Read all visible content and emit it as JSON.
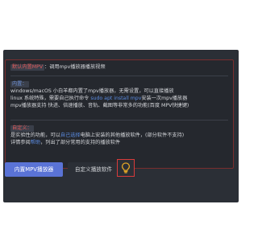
{
  "tooltip": {
    "section1": {
      "tag": "默认内置MPV",
      "text": "：调用mpv播放器播放视频"
    },
    "section2": {
      "tag": "内置：",
      "line1": "windows/macOS 小白羊都内置了mpv播放器，无需设置，可以直接播放",
      "line2_a": "linux 系统特殊，需要自己执行命令 ",
      "line2_cmd": "sudo apt install mpv",
      "line2_b": "安装一次mpv播放器",
      "line3": "mpv播放器支持 快进、倍速播放、音轨、截图等非常多的功能(百度 MPV快捷键)"
    },
    "section3": {
      "tag": "自定义：",
      "line1_a": "是实验性的功能，可以",
      "line1_link": "自己选择",
      "line1_b": "电脑上安装的其他播放软件，(部分软件不支持)",
      "line2_a": "详情参阅",
      "line2_link": "帮助",
      "line2_b": "，列出了部分常用的支持的播放软件"
    }
  },
  "buttons": {
    "builtin_mpv": "内置MPV播放器",
    "custom_player": "自定义播放软件"
  },
  "icons": {
    "help": "lightbulb-icon"
  },
  "colors": {
    "accent_red": "#e05a5a",
    "link_blue": "#5b8be0",
    "primary_button": "#5a73d6",
    "panel_bg": "#2b2f36",
    "highlight_border": "#d83b3b",
    "bulb": "#e0a526"
  }
}
